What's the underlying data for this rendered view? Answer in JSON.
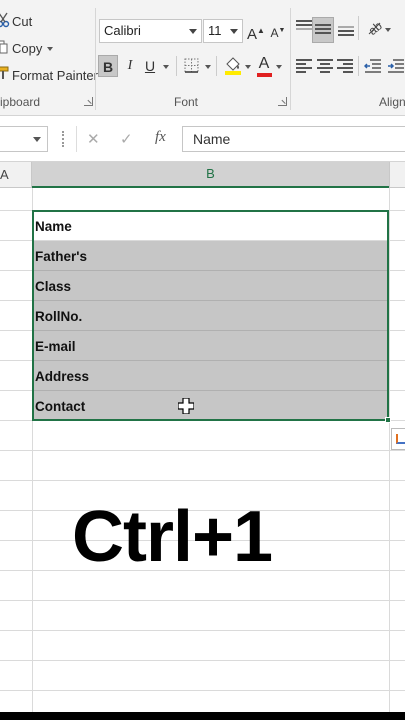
{
  "clipboard": {
    "cut_label": "Cut",
    "copy_label": "Copy",
    "format_painter_label": "Format Painter",
    "group_label": "ipboard"
  },
  "font": {
    "family": "Calibri",
    "size": "11",
    "grow_glyph": "A",
    "shrink_glyph": "A",
    "bold_glyph": "B",
    "italic_glyph": "I",
    "underline_glyph": "U",
    "font_color_glyph": "A",
    "group_label": "Font",
    "font_color": "#e02020",
    "highlight_color": "#ffeb00"
  },
  "alignment": {
    "group_label": "Align"
  },
  "formula_bar": {
    "fx_label": "fx",
    "cancel_glyph": "✕",
    "enter_glyph": "✓",
    "value": "Name"
  },
  "columns": {
    "a": "A",
    "b": "B"
  },
  "cells": [
    "Name",
    "Father's",
    "Class",
    "RollNo.",
    "E-mail",
    "Address",
    "Contact"
  ],
  "overlay_text": "Ctrl+1",
  "colors": {
    "accent": "#217346",
    "selection": "#c6c6c6"
  }
}
